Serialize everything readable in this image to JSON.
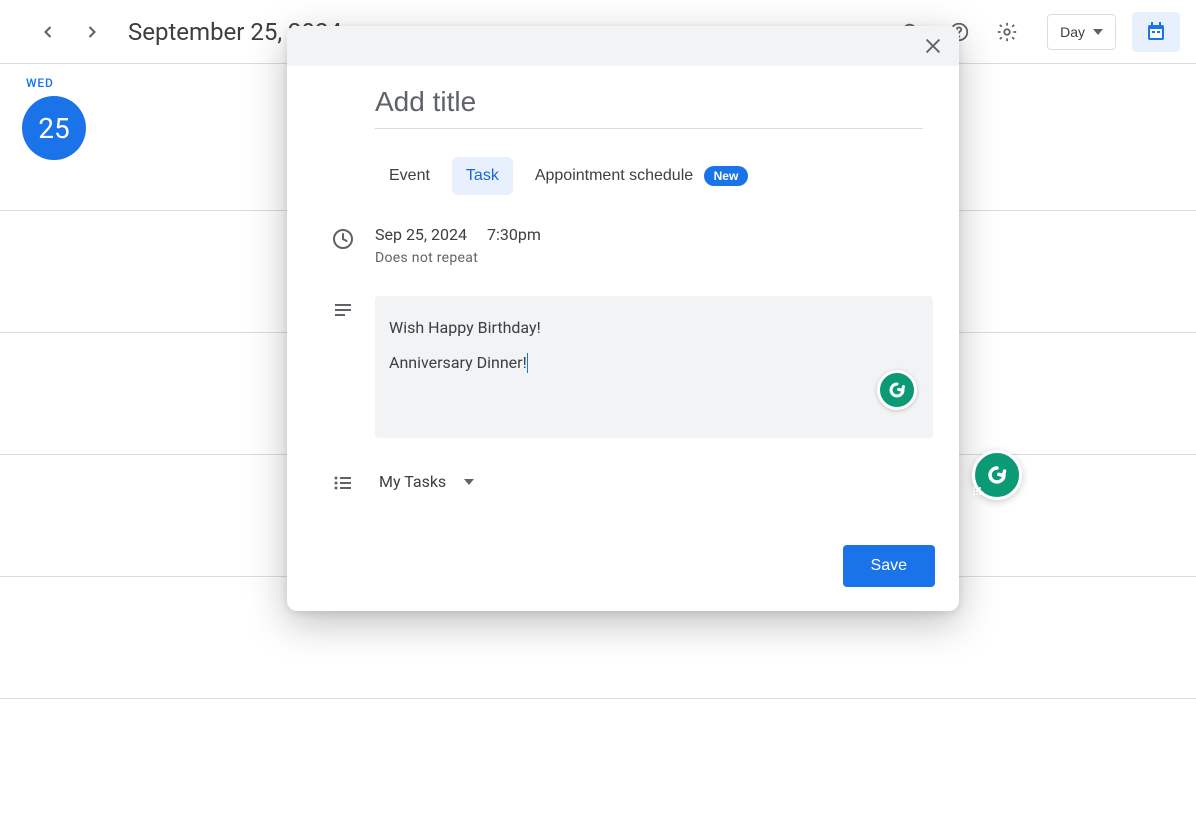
{
  "header": {
    "date_title": "September 25, 2024",
    "view_label": "Day"
  },
  "day": {
    "abbrev": "WED",
    "number": "25"
  },
  "modal": {
    "title_placeholder": "Add title",
    "tabs": {
      "event": "Event",
      "task": "Task",
      "appointment": "Appointment schedule",
      "new_badge": "New"
    },
    "date": "Sep 25, 2024",
    "time": "7:30pm",
    "repeat": "Does not repeat",
    "description_line1": "Wish Happy Birthday!",
    "description_line2": "Anniversary Dinner!",
    "tasklist": "My Tasks",
    "save": "Save"
  }
}
